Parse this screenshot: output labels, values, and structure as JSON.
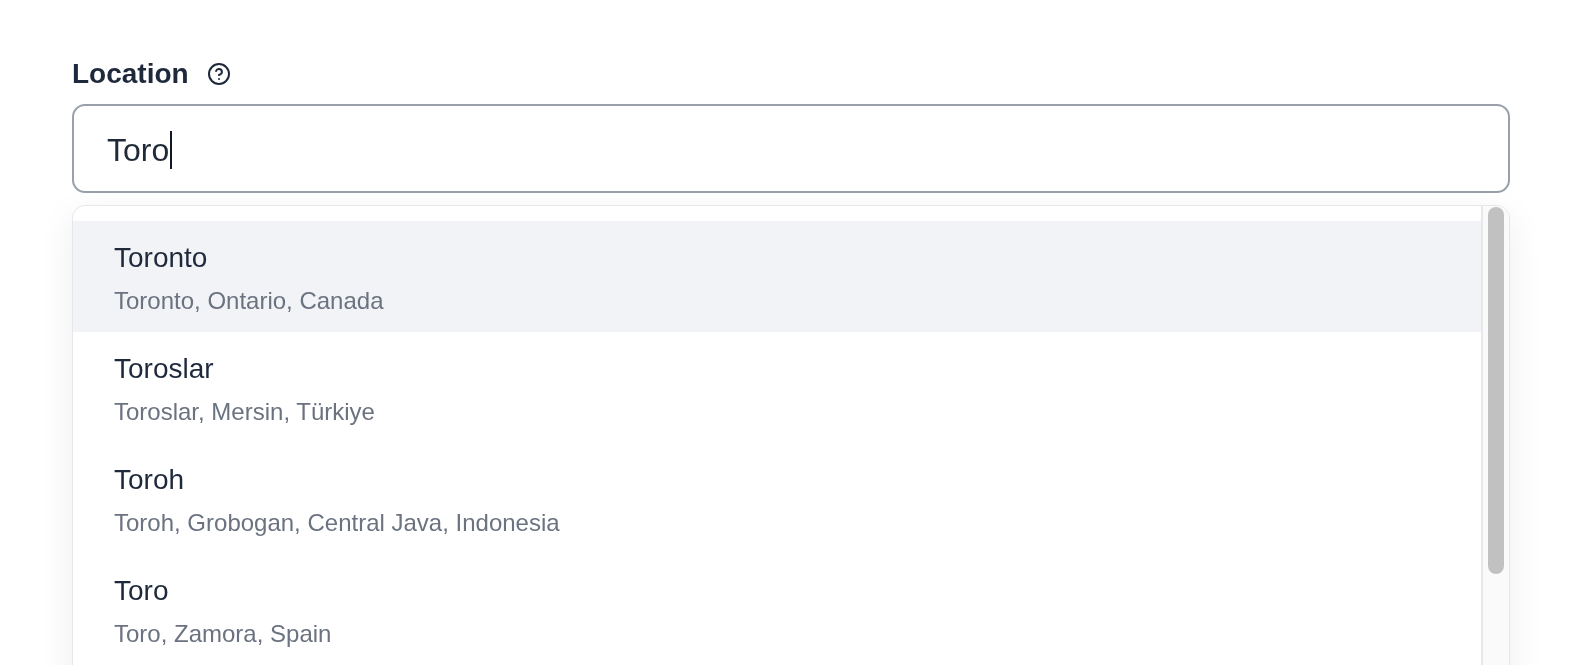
{
  "field": {
    "label": "Location",
    "value": "Toro",
    "focused": true
  },
  "suggestions": [
    {
      "name": "Toronto",
      "detail": "Toronto, Ontario, Canada",
      "selected": true
    },
    {
      "name": "Toroslar",
      "detail": "Toroslar, Mersin, Türkiye",
      "selected": false
    },
    {
      "name": "Toroh",
      "detail": "Toroh, Grobogan, Central Java, Indonesia",
      "selected": false
    },
    {
      "name": "Toro",
      "detail": "Toro, Zamora, Spain",
      "selected": false
    }
  ]
}
